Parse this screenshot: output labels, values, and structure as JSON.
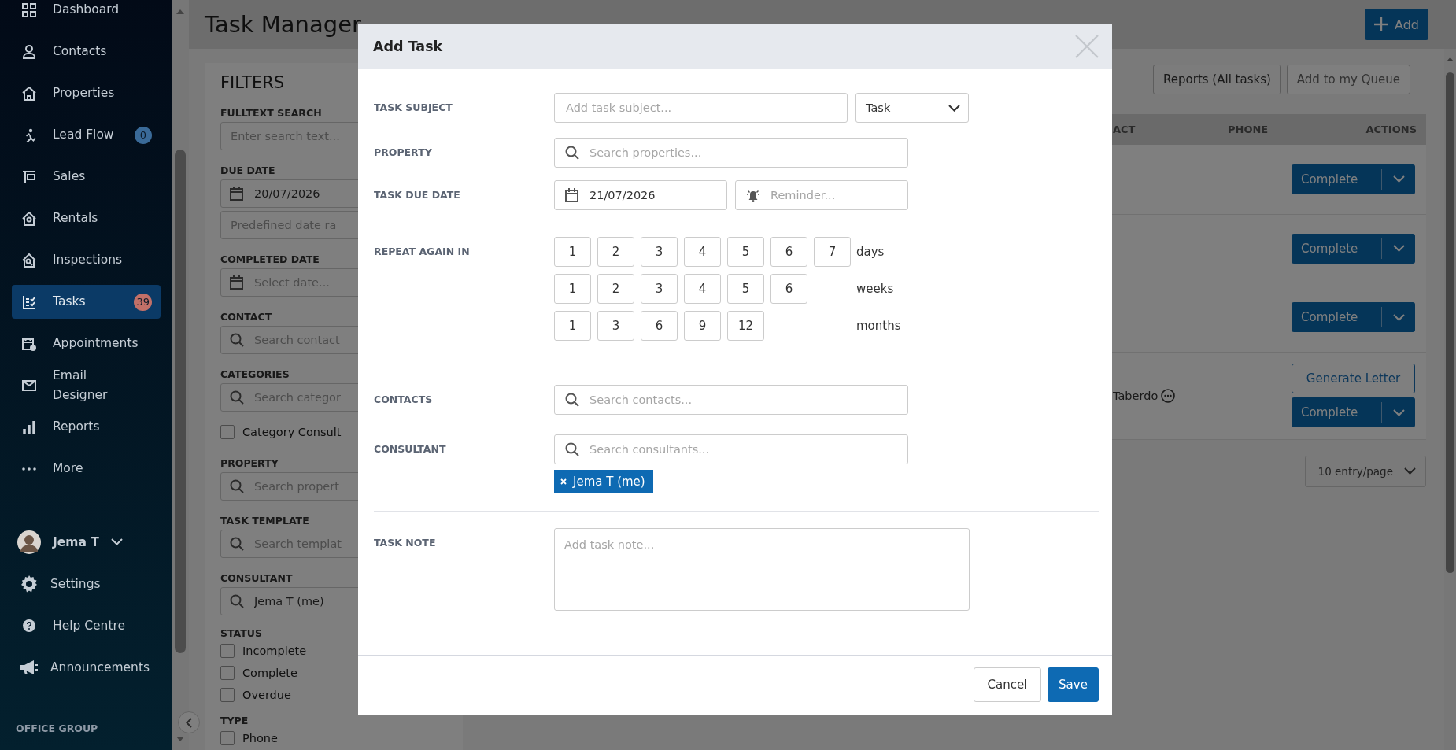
{
  "sidebar": {
    "items": [
      {
        "label": "Dashboard",
        "selected": false
      },
      {
        "label": "Contacts",
        "selected": false
      },
      {
        "label": "Properties",
        "selected": false
      },
      {
        "label": "Lead Flow",
        "selected": false,
        "badge": {
          "text": "0",
          "color": "#3a6a98"
        }
      },
      {
        "label": "Sales",
        "selected": false
      },
      {
        "label": "Rentals",
        "selected": false
      },
      {
        "label": "Inspections",
        "selected": false
      },
      {
        "label": "Tasks",
        "selected": true,
        "badge": {
          "text": "39",
          "color": "#c27068"
        }
      },
      {
        "label": "Appointments",
        "selected": false
      },
      {
        "label": "Email Designer",
        "selected": false
      },
      {
        "label": "Reports",
        "selected": false
      },
      {
        "label": "More",
        "selected": false
      }
    ],
    "user": {
      "name": "Jema T"
    },
    "bottom_items": [
      {
        "label": "Settings"
      },
      {
        "label": "Help Centre"
      },
      {
        "label": "Announcements"
      }
    ],
    "section_label": "OFFICE GROUP"
  },
  "page": {
    "title": "Task Manager",
    "add_button": "Add"
  },
  "filters": {
    "title": "FILTERS",
    "fields": [
      {
        "kind": "text",
        "label": "FULLTEXT SEARCH",
        "placeholder": "Enter search text..."
      },
      {
        "kind": "date",
        "label": "DUE DATE",
        "value": "20/07/2026"
      },
      {
        "kind": "text",
        "placeholder": "Predefined date ra"
      },
      {
        "kind": "date",
        "label": "COMPLETED DATE",
        "placeholder": "Select date..."
      },
      {
        "kind": "search",
        "label": "CONTACT",
        "placeholder": "Search contact"
      },
      {
        "kind": "search",
        "label": "CATEGORIES",
        "placeholder": "Search categor"
      },
      {
        "kind": "checkbox",
        "label": "Category Consult",
        "checked": false
      },
      {
        "kind": "search",
        "label": "PROPERTY",
        "placeholder": "Search propert"
      },
      {
        "kind": "search",
        "label": "TASK TEMPLATE",
        "placeholder": "Search templat"
      },
      {
        "kind": "search",
        "label": "CONSULTANT",
        "value": "Jema T (me)"
      },
      {
        "kind": "heading",
        "label": "STATUS"
      },
      {
        "kind": "checkbox",
        "label": "Incomplete",
        "checked": false
      },
      {
        "kind": "checkbox",
        "label": "Complete",
        "checked": false
      },
      {
        "kind": "checkbox",
        "label": "Overdue",
        "checked": false
      },
      {
        "kind": "heading",
        "label": "TYPE"
      },
      {
        "kind": "checkbox",
        "label": "Phone",
        "checked": false
      }
    ]
  },
  "table": {
    "toolbar_buttons": [
      "Reports (All tasks)",
      "Add to my Queue"
    ],
    "columns": [
      "ACT",
      "PHONE",
      "ACTIONS"
    ],
    "rows": [
      {
        "actions": [
          {
            "kind": "split",
            "label": "Complete"
          }
        ]
      },
      {
        "actions": [
          {
            "kind": "split",
            "label": "Complete"
          }
        ]
      },
      {
        "actions": [
          {
            "kind": "split",
            "label": "Complete"
          }
        ]
      },
      {
        "contact": "Taberdo",
        "actions": [
          {
            "kind": "outline",
            "label": "Generate Letter"
          },
          {
            "kind": "split",
            "label": "Complete"
          }
        ]
      }
    ],
    "page_size": "10 entry/page"
  },
  "dialog": {
    "title": "Add Task",
    "task_subject": {
      "label": "TASK SUBJECT",
      "placeholder": "Add task subject...",
      "type": "Task"
    },
    "property": {
      "label": "PROPERTY",
      "placeholder": "Search properties..."
    },
    "due_date": {
      "label": "TASK DUE DATE",
      "value": "21/07/2026",
      "reminder_placeholder": "Reminder..."
    },
    "repeat": {
      "label": "REPEAT AGAIN IN",
      "rows": [
        {
          "unit": "days",
          "options": [
            {
              "label": "1",
              "selected": false
            },
            {
              "label": "2",
              "selected": false
            },
            {
              "label": "3",
              "selected": false
            },
            {
              "label": "4",
              "selected": false
            },
            {
              "label": "5",
              "selected": false
            },
            {
              "label": "6",
              "selected": false
            },
            {
              "label": "7",
              "selected": false
            }
          ]
        },
        {
          "unit": "weeks",
          "options": [
            {
              "label": "1",
              "selected": false
            },
            {
              "label": "2",
              "selected": false
            },
            {
              "label": "3",
              "selected": false
            },
            {
              "label": "4",
              "selected": false
            },
            {
              "label": "5",
              "selected": false
            },
            {
              "label": "6",
              "selected": false
            }
          ]
        },
        {
          "unit": "months",
          "options": [
            {
              "label": "1",
              "selected": false
            },
            {
              "label": "3",
              "selected": false
            },
            {
              "label": "6",
              "selected": false
            },
            {
              "label": "9",
              "selected": false
            },
            {
              "label": "12",
              "selected": false
            }
          ]
        }
      ]
    },
    "contacts": {
      "label": "CONTACTS",
      "placeholder": "Search contacts..."
    },
    "consultant": {
      "label": "CONSULTANT",
      "placeholder": "Search consultants...",
      "tags": [
        "Jema T (me)"
      ]
    },
    "note": {
      "label": "TASK NOTE",
      "placeholder": "Add task note..."
    },
    "buttons": [
      {
        "kind": "secondary",
        "label": "Cancel"
      },
      {
        "kind": "primary",
        "label": "Save"
      }
    ]
  }
}
